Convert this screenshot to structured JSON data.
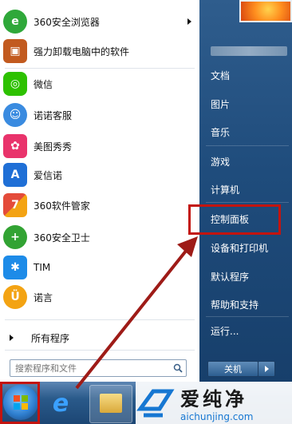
{
  "programs": [
    {
      "label": "360安全浏览器",
      "icon": "360-browser-icon",
      "color": "#2fa83a"
    },
    {
      "label": "强力卸载电脑中的软件",
      "icon": "uninstall-box-icon",
      "color": "#c25a1f"
    },
    {
      "label": "微信",
      "icon": "wechat-icon",
      "color": "#2dc100"
    },
    {
      "label": "诺诺客服",
      "icon": "nuonuo-service-icon",
      "color": "#3a8be0"
    },
    {
      "label": "美图秀秀",
      "icon": "meitu-icon",
      "color": "#e9336b"
    },
    {
      "label": "爱信诺",
      "icon": "aisino-icon",
      "color": "#1f6fd6"
    },
    {
      "label": "360软件管家",
      "icon": "360-software-manager-icon",
      "color": "#e44b3a"
    },
    {
      "label": "360安全卫士",
      "icon": "360-security-icon",
      "color": "#32a333"
    },
    {
      "label": "TIM",
      "icon": "tim-icon",
      "color": "#1d8be8"
    },
    {
      "label": "诺言",
      "icon": "nuoyan-icon",
      "color": "#f3a313"
    }
  ],
  "all_programs": "所有程序",
  "search_placeholder": "搜索程序和文件",
  "right_items": [
    "文档",
    "图片",
    "音乐",
    "游戏",
    "计算机",
    "控制面板",
    "设备和打印机",
    "默认程序",
    "帮助和支持",
    "运行..."
  ],
  "shutdown_label": "关机",
  "watermark": {
    "brand": "爱纯净",
    "url": "aichunjing.com"
  },
  "colors": {
    "highlight": "#c3140f",
    "arrow": "#9e1b17"
  }
}
